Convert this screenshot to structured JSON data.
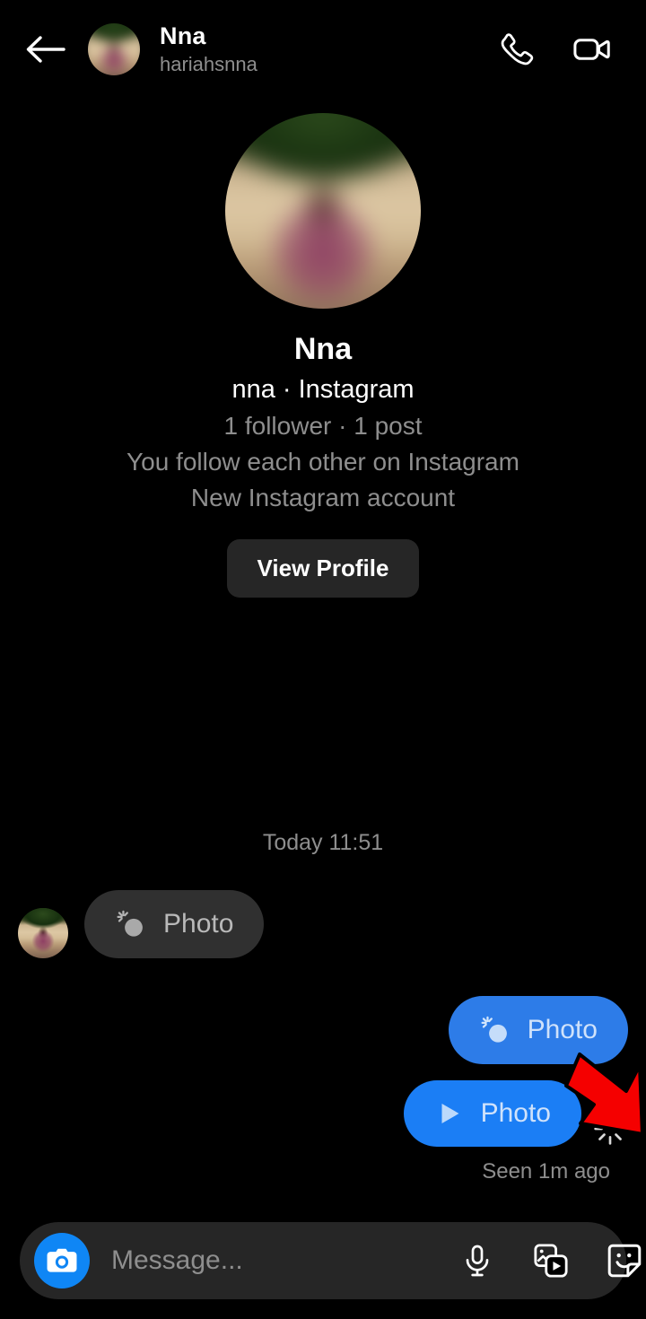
{
  "app": {
    "theme": "dark",
    "background": "#000000"
  },
  "header": {
    "back_icon": "back-arrow-icon",
    "title": "Nna",
    "subtitle": "hariahsnna",
    "avatar_alt": "profile-photo-blurred",
    "call_icon": "phone-icon",
    "video_icon": "video-camera-icon"
  },
  "profile": {
    "avatar_alt": "profile-photo-blurred-large",
    "name": "Nna",
    "handle": "nna · Instagram",
    "stats": "1 follower · 1 post",
    "relationship": "You follow each other on Instagram",
    "note": "New Instagram account",
    "view_profile_label": "View Profile",
    "view_profile_bg": "#262626"
  },
  "conversation": {
    "day_separator": "Today 11:51",
    "messages": [
      {
        "direction": "incoming",
        "label": "Photo",
        "icon": "vanish-photo-icon",
        "avatar_alt": "sender-avatar",
        "bubble_color": "#303030"
      },
      {
        "direction": "outgoing",
        "label": "Photo",
        "icon": "vanish-photo-icon",
        "bubble_color": "#2d7ce8"
      },
      {
        "direction": "outgoing",
        "label": "Photo",
        "icon": "play-icon",
        "bubble_color": "#1b7ef5",
        "status_icon": "sparkle-burst-icon"
      }
    ],
    "receipt": "Seen 1m ago"
  },
  "annotation": {
    "type": "red-arrow",
    "color": "#ff0000",
    "points_to": "sparkle-burst-icon"
  },
  "composer": {
    "camera_icon": "camera-icon",
    "camera_bg": "#0f86f5",
    "placeholder": "Message...",
    "value": "",
    "mic_icon": "microphone-icon",
    "gallery_icon": "media-gallery-icon",
    "sticker_icon": "sticker-icon"
  }
}
